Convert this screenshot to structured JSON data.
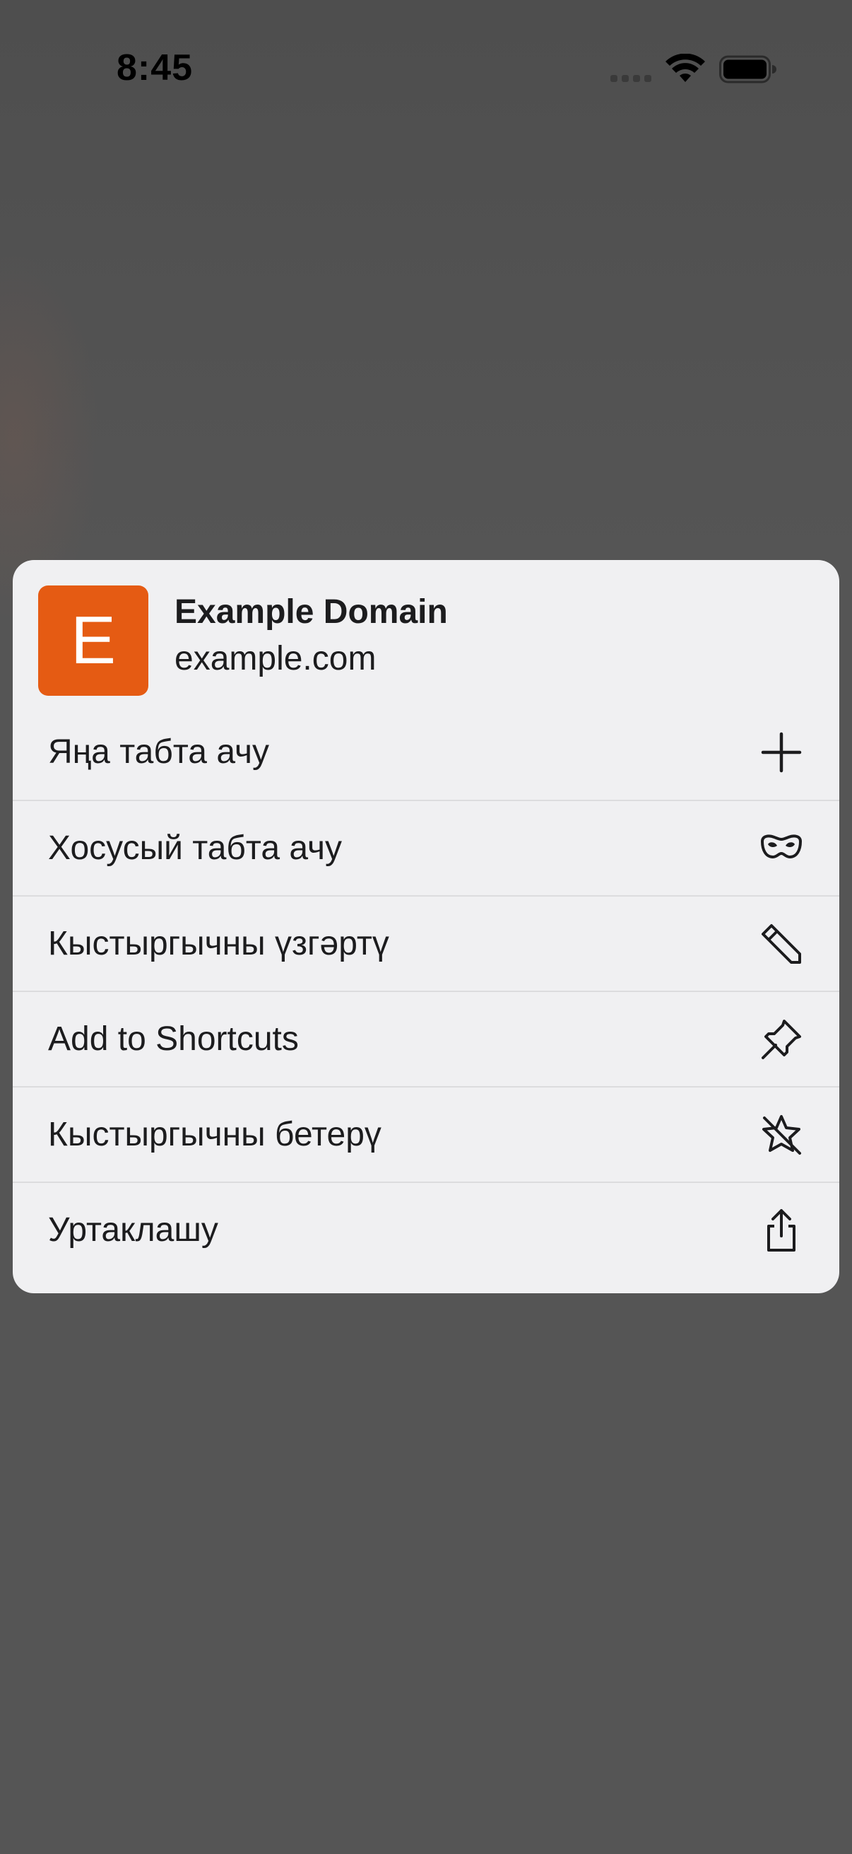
{
  "status_bar": {
    "time": "8:45",
    "icons": [
      "signal-dots-icon",
      "wifi-icon",
      "battery-icon"
    ]
  },
  "context_menu": {
    "header": {
      "favicon_letter": "E",
      "favicon_color": "#e55b13",
      "title": "Example Domain",
      "url": "example.com"
    },
    "items": [
      {
        "label": "Яңа табта ачу",
        "icon": "plus-icon"
      },
      {
        "label": "Хосусый табта ачу",
        "icon": "private-mask-icon"
      },
      {
        "label": "Кыстыргычны үзгәртү",
        "icon": "pencil-icon"
      },
      {
        "label": "Add to Shortcuts",
        "icon": "pin-icon"
      },
      {
        "label": "Кыстыргычны бетерү",
        "icon": "star-slash-icon"
      },
      {
        "label": "Уртаклашу",
        "icon": "share-icon"
      }
    ]
  }
}
